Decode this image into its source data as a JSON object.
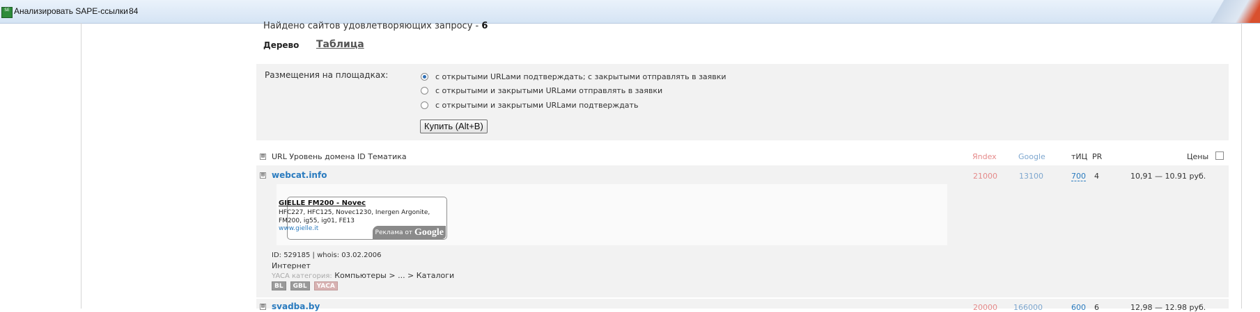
{
  "window": {
    "title": "Анализировать SAPE-ссылки",
    "count": "84",
    "icon_name": "app-grid-icon",
    "icon_glyph": "SE"
  },
  "results": {
    "found_label": "Найдено сайтов удовлетворяющих запросу -",
    "found_count": "6",
    "tabs": {
      "tree": "Дерево",
      "table": "Таблица"
    }
  },
  "placement": {
    "label": "Размещения на площадках:",
    "options": [
      {
        "label": "с открытыми URLами подтверждать; с закрытыми отправлять в заявки",
        "checked": true
      },
      {
        "label": "с открытыми и закрытыми URLами отправлять в заявки",
        "checked": false
      },
      {
        "label": "с открытыми и закрытыми URLами подтверждать",
        "checked": false
      }
    ],
    "buy_button": "Купить (Alt+B)"
  },
  "table": {
    "header": {
      "expand": "⊞",
      "labels": "URL Уровень домена ID Тематика",
      "yandex": "Яndex",
      "google": "Google",
      "tic": "тИЦ",
      "pr": "PR",
      "price": "Цены"
    },
    "rows": [
      {
        "expand": "⊞",
        "site": "webcat.info",
        "yandex": "21000",
        "google": "13100",
        "tic": "700",
        "pr": "4",
        "price": "10,91 — 10.91 руб.",
        "ad": {
          "title": "GIELLE FM200 - Novec",
          "description": "HFC227, HFC125, Novec1230, Inergen Argonite, FM200, ig55, ig01, FE13",
          "url": "www.gielle.it",
          "badge_text": "Реклама от",
          "badge_brand": "Google"
        },
        "info_id": "ID: 529185 | whois: 03.02.2006",
        "category": "Интернет",
        "yaca_label": "YACA категория:",
        "yaca_path": "Компьютеры > ... > Каталоги",
        "badges": [
          "BL",
          "GBL",
          "YACA"
        ]
      },
      {
        "expand": "⊞",
        "site": "svadba.by",
        "yandex": "20000",
        "google": "166000",
        "tic": "600",
        "pr": "6",
        "price": "12,98 — 12.98 руб."
      }
    ]
  },
  "colors": {
    "link": "#2a7bbf",
    "yandex": "#e58a8a",
    "google": "#7ea7cf",
    "panel": "#f2f2f2"
  }
}
